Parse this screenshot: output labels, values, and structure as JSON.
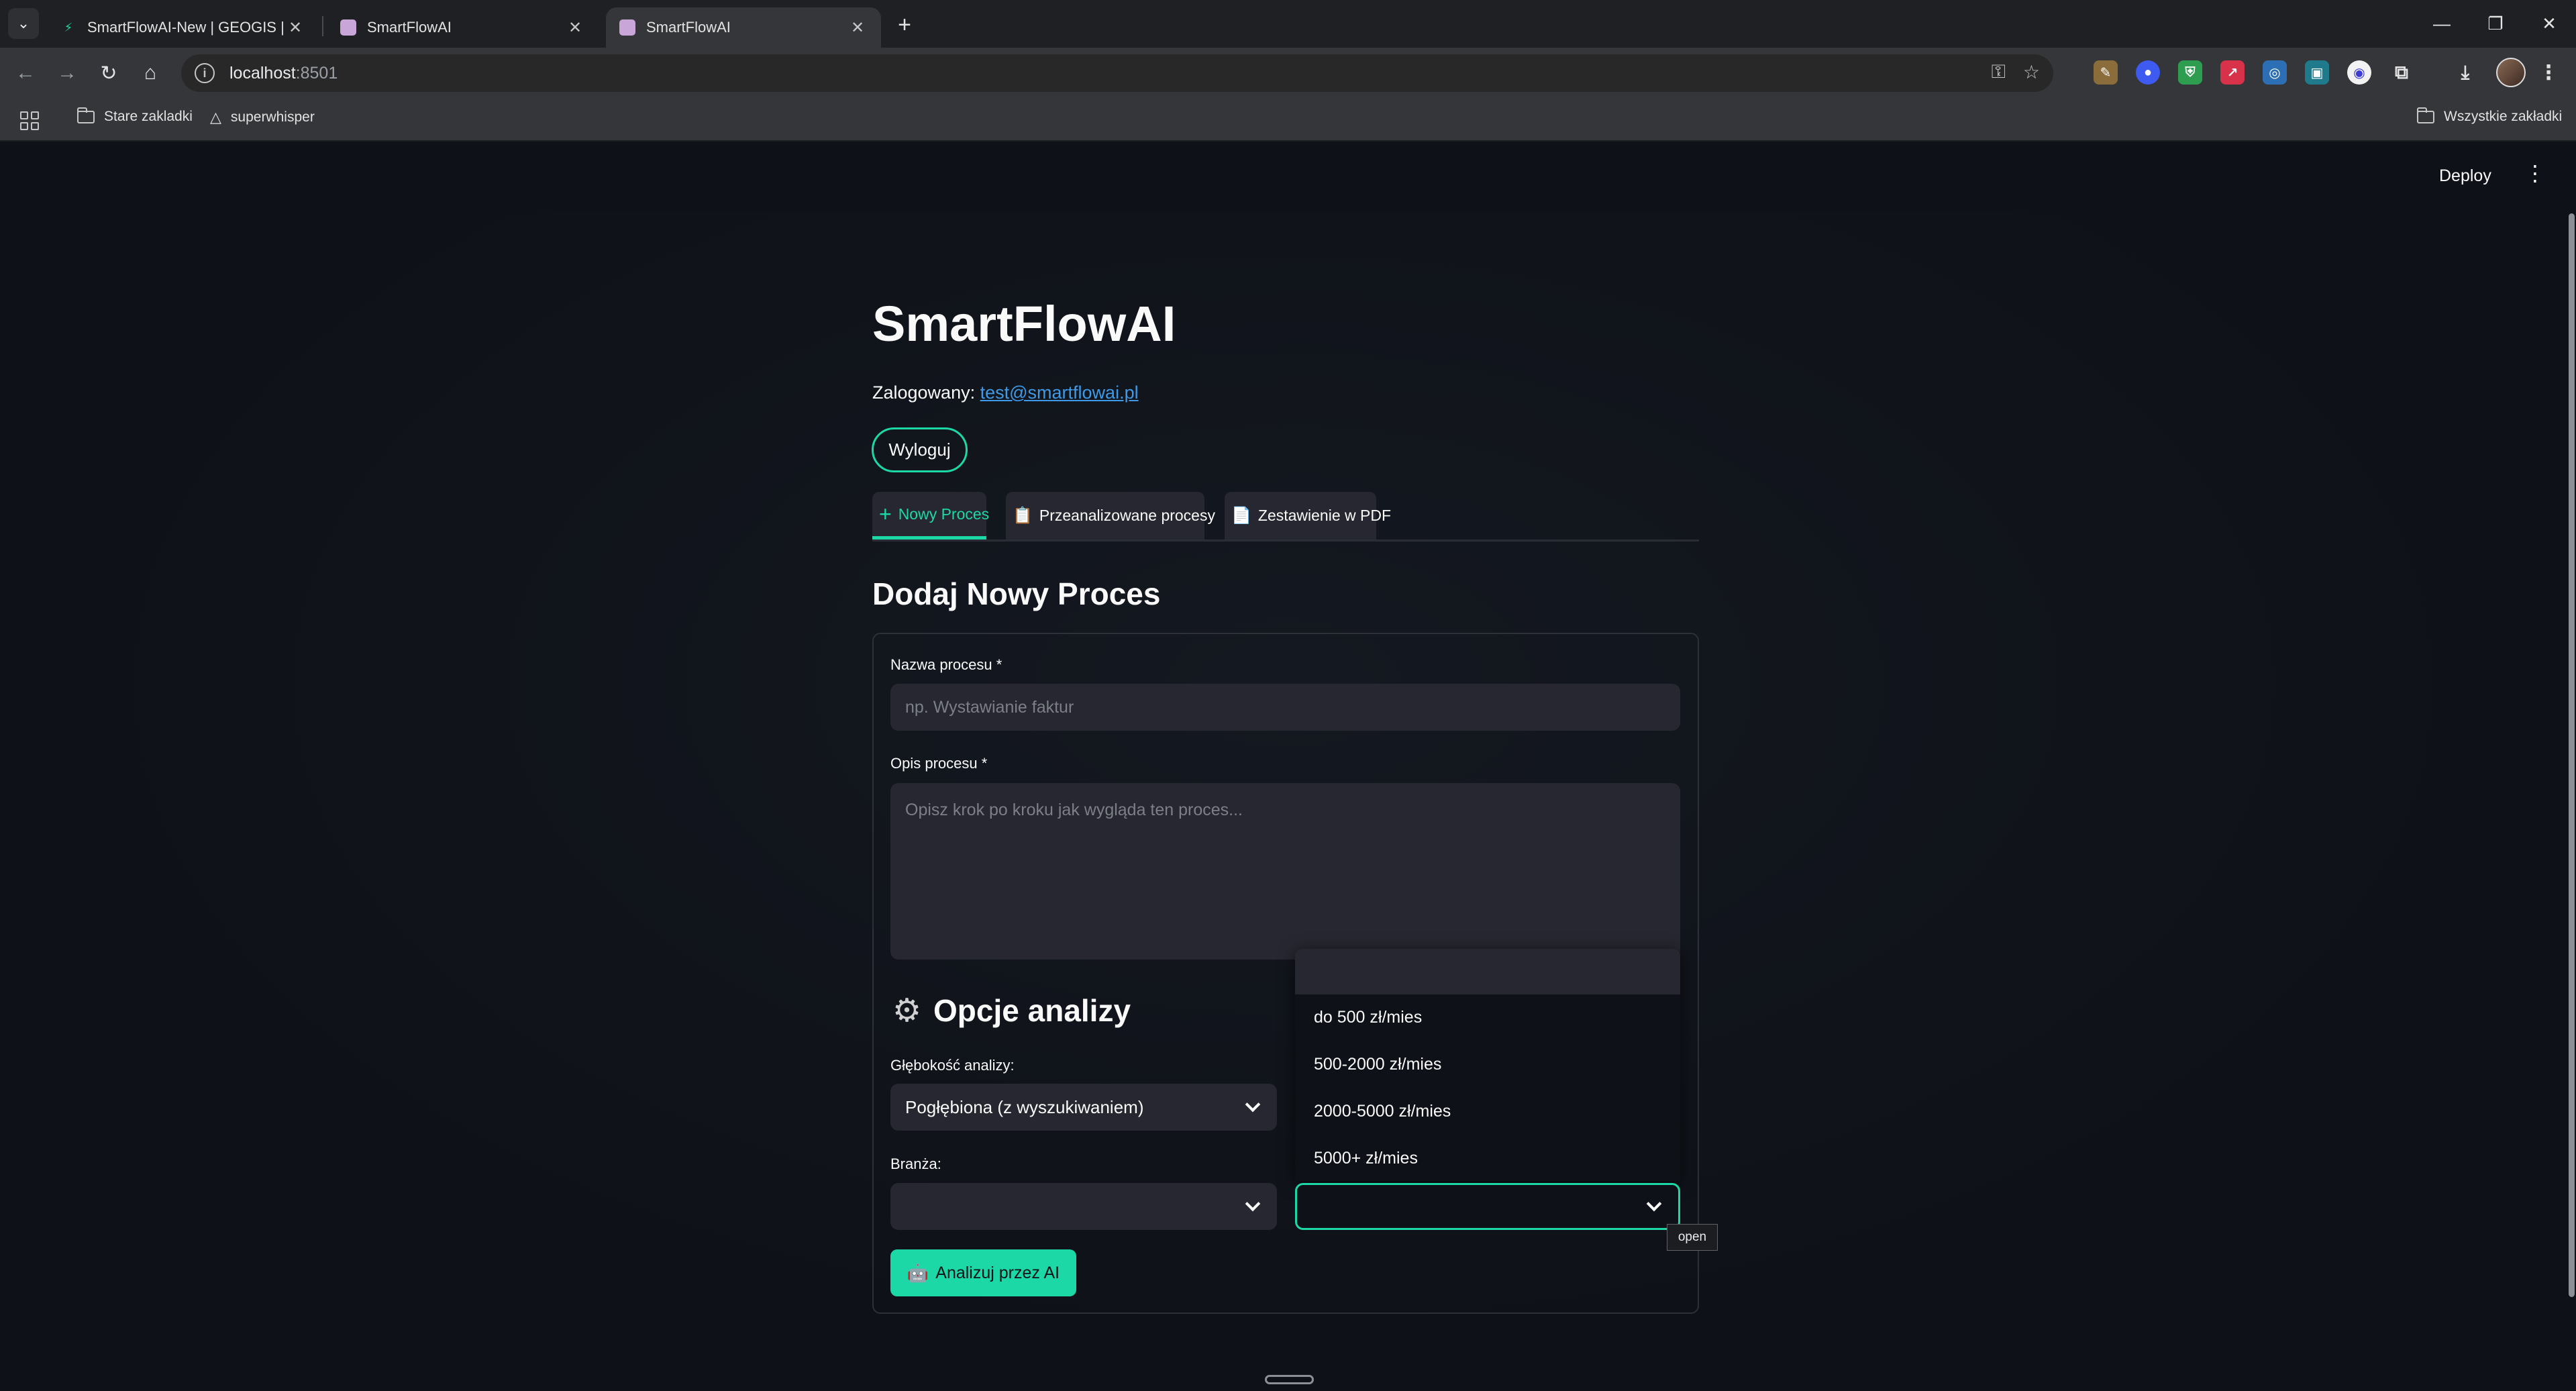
{
  "browser": {
    "tabs": [
      {
        "title": "SmartFlowAI-New | GEOGIS | Su",
        "favicon": "bolt-icon",
        "active": false
      },
      {
        "title": "SmartFlowAI",
        "favicon": "robot-icon",
        "active": false
      },
      {
        "title": "SmartFlowAI",
        "favicon": "robot-icon",
        "active": true
      }
    ],
    "url_host": "localhost",
    "url_port": ":8501",
    "bookmarks": [
      {
        "label": "Stare zakladki",
        "icon": "folder-icon"
      },
      {
        "label": "superwhisper",
        "icon": "triangle-icon"
      }
    ],
    "all_bookmarks": "Wszystkie zakładki"
  },
  "app": {
    "deploy_label": "Deploy",
    "title": "SmartFlowAI",
    "logged_in_label": "Zalogowany:",
    "logged_in_email": "test@smartflowai.pl",
    "logout_label": "Wyloguj",
    "tabs": [
      {
        "icon": "+",
        "label": "Nowy Proces",
        "active": true
      },
      {
        "icon": "📋",
        "label": "Przeanalizowane procesy",
        "active": false
      },
      {
        "icon": "📄",
        "label": "Zestawienie w PDF",
        "active": false
      }
    ],
    "section_title": "Dodaj Nowy Proces",
    "form": {
      "name_label": "Nazwa procesu *",
      "name_placeholder": "np. Wystawianie faktur",
      "desc_label": "Opis procesu *",
      "desc_placeholder": "Opisz krok po kroku jak wygląda ten proces...",
      "options_title": "Opcje analizy",
      "depth_label": "Głębokość analizy:",
      "depth_value": "Pogłębiona (z wyszukiwaniem)",
      "industry_label": "Branża:",
      "industry_value": "",
      "budget_value": "",
      "budget_options": [
        "do 500 zł/mies",
        "500-2000 zł/mies",
        "2000-5000 zł/mies",
        "5000+ zł/mies"
      ],
      "tooltip": "open",
      "analyze_label": "Analizuj przez AI"
    },
    "accent_color": "#1bd8a6",
    "link_color": "#3d9ae8"
  }
}
